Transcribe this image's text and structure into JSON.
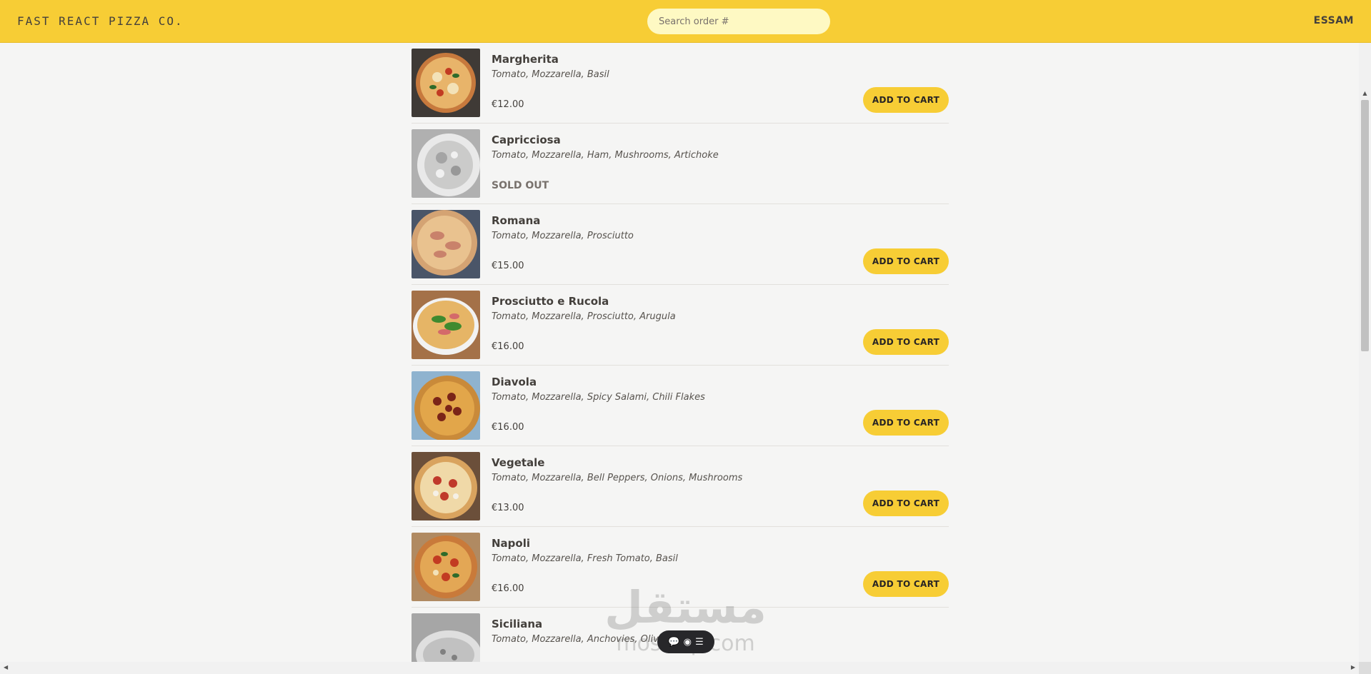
{
  "header": {
    "logo": "FAST REACT PIZZA CO.",
    "search_placeholder": "Search order #",
    "username": "ESSAM"
  },
  "menu": {
    "add_label": "ADD TO CART",
    "items": [
      {
        "name": "Margherita",
        "ingredients": "Tomato, Mozzarella, Basil",
        "price": "€12.00",
        "sold_out": false
      },
      {
        "name": "Capricciosa",
        "ingredients": "Tomato, Mozzarella, Ham, Mushrooms, Artichoke",
        "price": "SOLD OUT",
        "sold_out": true
      },
      {
        "name": "Romana",
        "ingredients": "Tomato, Mozzarella, Prosciutto",
        "price": "€15.00",
        "sold_out": false
      },
      {
        "name": "Prosciutto e Rucola",
        "ingredients": "Tomato, Mozzarella, Prosciutto, Arugula",
        "price": "€16.00",
        "sold_out": false
      },
      {
        "name": "Diavola",
        "ingredients": "Tomato, Mozzarella, Spicy Salami, Chili Flakes",
        "price": "€16.00",
        "sold_out": false
      },
      {
        "name": "Vegetale",
        "ingredients": "Tomato, Mozzarella, Bell Peppers, Onions, Mushrooms",
        "price": "€13.00",
        "sold_out": false
      },
      {
        "name": "Napoli",
        "ingredients": "Tomato, Mozzarella, Fresh Tomato, Basil",
        "price": "€16.00",
        "sold_out": false
      },
      {
        "name": "Siciliana",
        "ingredients": "Tomato, Mozzarella, Anchovies, Olives,",
        "price": "",
        "sold_out": true
      }
    ]
  },
  "toolbar": {
    "icons": [
      "chat-icon",
      "message-icon",
      "list-icon"
    ],
    "glyphs": [
      "💬",
      "◉",
      "☰"
    ]
  },
  "watermark": {
    "logo_text": "مستقل",
    "site_text": "mostaql.com"
  },
  "colors": {
    "accent": "#f7cd35",
    "background": "#f5f5f4",
    "search_bg": "#fef9c3",
    "text": "#44403c"
  }
}
